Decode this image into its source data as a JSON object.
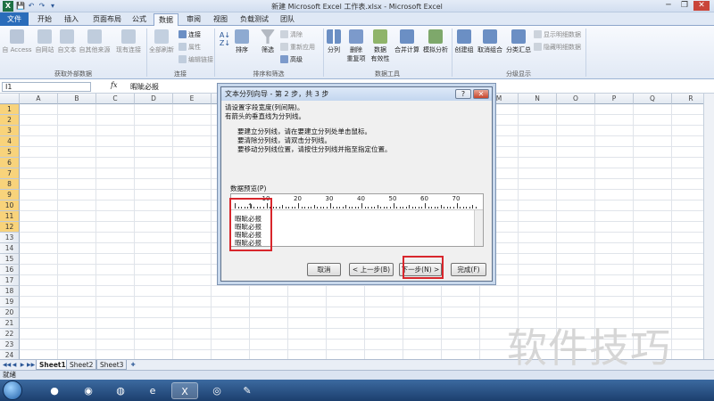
{
  "window": {
    "title": "新建 Microsoft Excel 工作表.xlsx - Microsoft Excel",
    "app_icon": "X"
  },
  "quick_access": {
    "save": "💾",
    "undo": "↶",
    "redo": "↷",
    "more": "▾"
  },
  "window_controls": {
    "minimize": "─",
    "restore": "❐",
    "close": "✕"
  },
  "tabs": [
    "文件",
    "开始",
    "插入",
    "页面布局",
    "公式",
    "数据",
    "审阅",
    "视图",
    "负载测试",
    "团队"
  ],
  "ribbon": {
    "get_external": [
      "自 Access",
      "自网站",
      "自文本",
      "自其他来源",
      "现有连接"
    ],
    "refresh_all": "全部刷新",
    "connections": [
      "连接",
      "属性",
      "编辑链接"
    ],
    "sort": [
      "排序",
      "筛选"
    ],
    "filter_small": [
      "清除",
      "重新应用",
      "高级"
    ],
    "data_tools": [
      "分列",
      "删除\n重复项",
      "数据\n有效性",
      "合并计算",
      "模拟分析"
    ],
    "outline": [
      "创建组",
      "取消组合",
      "分类汇总"
    ],
    "outline_small": [
      "显示明细数据",
      "隐藏明细数据"
    ],
    "groups": [
      "获取外部数据",
      "连接",
      "排序和筛选",
      "数据工具",
      "分级显示"
    ]
  },
  "formula_bar": {
    "name_box": "I1",
    "fx": "fx",
    "value": "暇眦必报"
  },
  "columns": [
    "A",
    "B",
    "C",
    "D",
    "E",
    "F",
    "G",
    "H",
    "I",
    "J",
    "K",
    "L",
    "M",
    "N",
    "O",
    "P",
    "Q",
    "R"
  ],
  "rows": [
    "1",
    "2",
    "3",
    "4",
    "5",
    "6",
    "7",
    "8",
    "9",
    "10",
    "11",
    "12",
    "13",
    "14",
    "15",
    "16",
    "17",
    "18",
    "19",
    "20",
    "21",
    "22",
    "23",
    "24"
  ],
  "sheet_tabs": [
    "Sheet1",
    "Sheet2",
    "Sheet3"
  ],
  "status": "就绪",
  "dialog": {
    "title": "文本分列向导 - 第 2 步，共 3 步",
    "help": "?",
    "close": "✕",
    "line1": "请设置字段宽度(列间隔)。",
    "line2": "有箭头的垂直线为分列线。",
    "bullet1": "要建立分列线，请在要建立分列处单击鼠标。",
    "bullet2": "要清除分列线，请双击分列线。",
    "bullet3": "要移动分列线位置，请按住分列线并拖至指定位置。",
    "preview_label": "数据预览(P)",
    "ruler": [
      "10",
      "20",
      "30",
      "40",
      "50",
      "60",
      "70"
    ],
    "preview_rows": [
      "暇眦必报",
      "暇眦必报",
      "暇眦必报",
      "暇眦必报"
    ],
    "buttons": {
      "cancel": "取消",
      "back": "< 上一步(B)",
      "next": "下一步(N) >",
      "finish": "完成(F)"
    }
  },
  "watermark": "软件技巧"
}
